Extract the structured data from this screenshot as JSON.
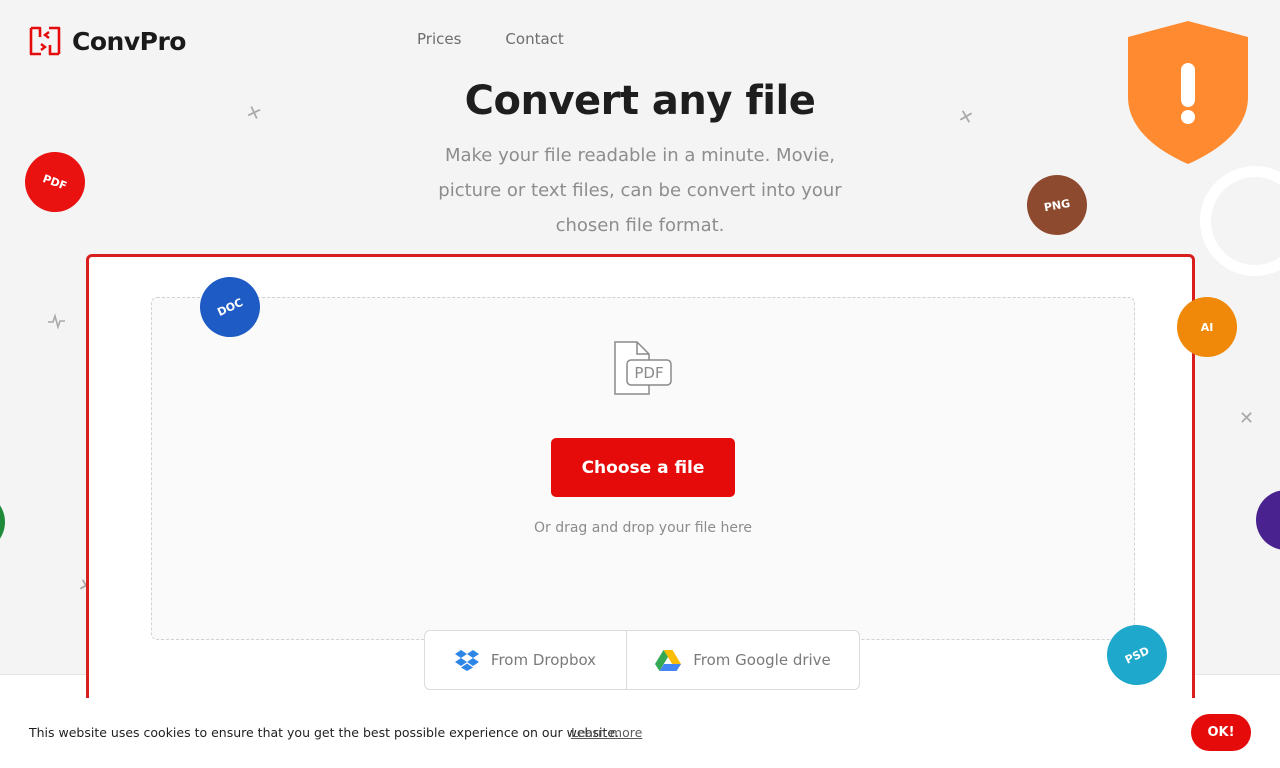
{
  "brand": {
    "name": "ConvPro",
    "icon": "convert-arrows-icon",
    "color": "#e60b0b"
  },
  "nav": {
    "items": [
      "Prices",
      "Contact"
    ]
  },
  "hero": {
    "title": "Convert any file",
    "subtitle": "Make your file readable in a minute. Movie, picture or text files, can be convert into your chosen file format."
  },
  "upload": {
    "file_icon": "pdf-file-icon",
    "file_icon_text": "PDF",
    "choose_label": "Choose a file",
    "drag_hint": "Or drag and drop your file here",
    "sources": [
      {
        "label": "From Dropbox",
        "icon": "dropbox-icon"
      },
      {
        "label": "From Google drive",
        "icon": "google-drive-icon"
      }
    ]
  },
  "badges": {
    "pdf": {
      "label": "PDF",
      "color": "#ea1111"
    },
    "doc": {
      "label": "DOC",
      "color": "#1f5bc4"
    },
    "png": {
      "label": "PNG",
      "color": "#8e4a2e"
    },
    "ai": {
      "label": "AI",
      "color": "#f0890a"
    },
    "psd": {
      "label": "PSD",
      "color": "#1ea8cc"
    },
    "green": {
      "label": "",
      "color": "#1e8a3a"
    },
    "purple": {
      "label": "",
      "color": "#4a2290"
    }
  },
  "security_icon": {
    "icon": "shield-warning-icon",
    "color": "#ff8a2f"
  },
  "cookie": {
    "text": "This website uses cookies to ensure that you get the best possible experience on our website.",
    "link": "Learn more",
    "button": "OK!"
  }
}
